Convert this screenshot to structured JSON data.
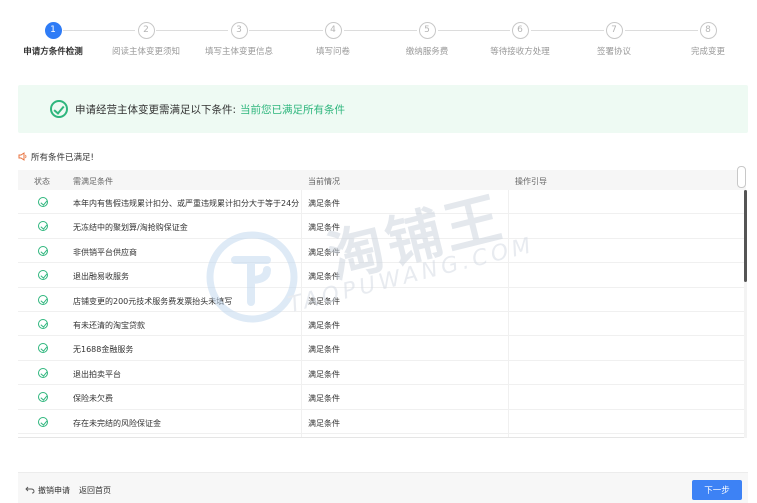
{
  "steps": [
    {
      "num": "1",
      "label": "申请方条件检测"
    },
    {
      "num": "2",
      "label": "阅读主体变更须知"
    },
    {
      "num": "3",
      "label": "填写主体变更信息"
    },
    {
      "num": "4",
      "label": "填写问卷"
    },
    {
      "num": "5",
      "label": "缴纳服务费"
    },
    {
      "num": "6",
      "label": "等待接收方处理"
    },
    {
      "num": "7",
      "label": "签署协议"
    },
    {
      "num": "8",
      "label": "完成变更"
    }
  ],
  "notice": {
    "text": "申请经营主体变更需满足以下条件:",
    "status": "当前您已满足所有条件"
  },
  "horn_text": "所有条件已满足!",
  "table": {
    "headers": {
      "state": "状态",
      "condition": "需满足条件",
      "current": "当前情况",
      "guide": "操作引导"
    },
    "rows": [
      {
        "condition": "本年内有售假违规累计扣分、或严重违规累计扣分大于等于24分",
        "current": "满足条件"
      },
      {
        "condition": "无冻结中的聚划算/淘抢购保证金",
        "current": "满足条件"
      },
      {
        "condition": "非供销平台供应商",
        "current": "满足条件"
      },
      {
        "condition": "退出融易收服务",
        "current": "满足条件"
      },
      {
        "condition": "店铺变更的200元技术服务费发票抬头未填写",
        "current": "满足条件"
      },
      {
        "condition": "有未还清的淘宝贷款",
        "current": "满足条件"
      },
      {
        "condition": "无1688金融服务",
        "current": "满足条件"
      },
      {
        "condition": "退出拍卖平台",
        "current": "满足条件"
      },
      {
        "condition": "保险未欠费",
        "current": "满足条件"
      },
      {
        "condition": "存在未完结的风险保证金",
        "current": "满足条件"
      }
    ]
  },
  "watermark": {
    "cn": "淘铺王",
    "en": "TAOPUWANG.COM"
  },
  "footer": {
    "undo": "撤销申请",
    "home": "返回首页",
    "next": "下一步"
  },
  "colors": {
    "accent": "#3d82f5",
    "success": "#2eb67d",
    "notice_bg": "#eefaf3"
  }
}
